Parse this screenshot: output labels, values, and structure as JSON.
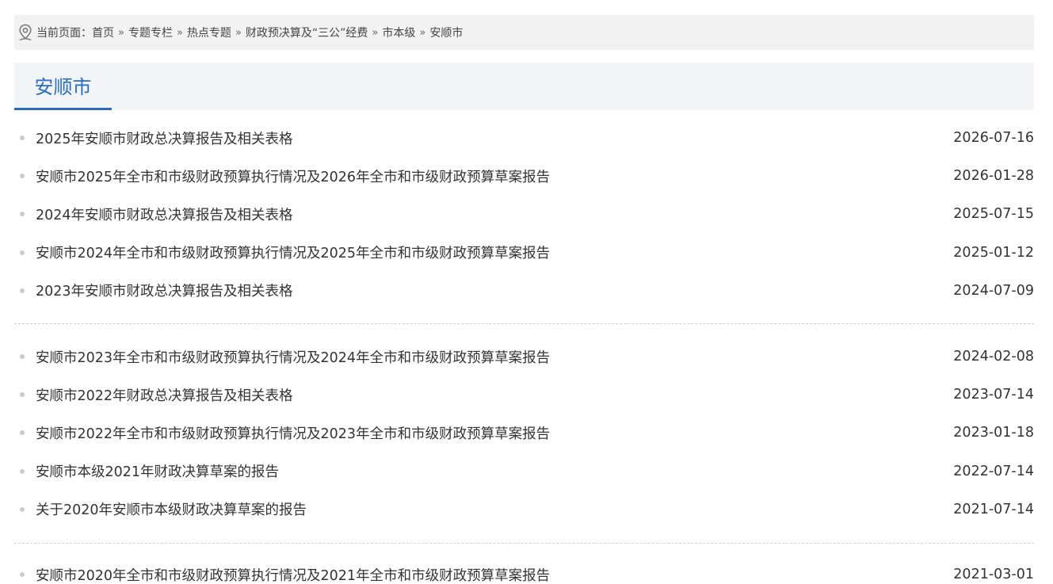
{
  "breadcrumb": {
    "prefix": "当前页面：",
    "crumbs": [
      "首页",
      "专题专栏",
      "热点专题",
      "财政预决算及“三公”经费",
      "市本级",
      "安顺市"
    ],
    "separator": "»"
  },
  "section": {
    "title": "安顺市"
  },
  "groups": [
    {
      "items": [
        {
          "title": "2025年安顺市财政总决算报告及相关表格",
          "date": "2026-07-16"
        },
        {
          "title": "安顺市2025年全市和市级财政预算执行情况及2026年全市和市级财政预算草案报告",
          "date": "2026-01-28"
        },
        {
          "title": "2024年安顺市财政总决算报告及相关表格",
          "date": "2025-07-15"
        },
        {
          "title": "安顺市2024年全市和市级财政预算执行情况及2025年全市和市级财政预算草案报告",
          "date": "2025-01-12"
        },
        {
          "title": "2023年安顺市财政总决算报告及相关表格",
          "date": "2024-07-09"
        }
      ]
    },
    {
      "items": [
        {
          "title": "安顺市2023年全市和市级财政预算执行情况及2024年全市和市级财政预算草案报告",
          "date": "2024-02-08"
        },
        {
          "title": "安顺市2022年财政总决算报告及相关表格",
          "date": "2023-07-14"
        },
        {
          "title": "安顺市2022年全市和市级财政预算执行情况及2023年全市和市级财政预算草案报告",
          "date": "2023-01-18"
        },
        {
          "title": "安顺市本级2021年财政决算草案的报告",
          "date": "2022-07-14"
        },
        {
          "title": "关于2020年安顺市本级财政决算草案的报告",
          "date": "2021-07-14"
        }
      ]
    },
    {
      "items": [
        {
          "title": "安顺市2020年全市和市级财政预算执行情况及2021年全市和市级财政预算草案报告",
          "date": "2021-03-01"
        }
      ]
    }
  ]
}
